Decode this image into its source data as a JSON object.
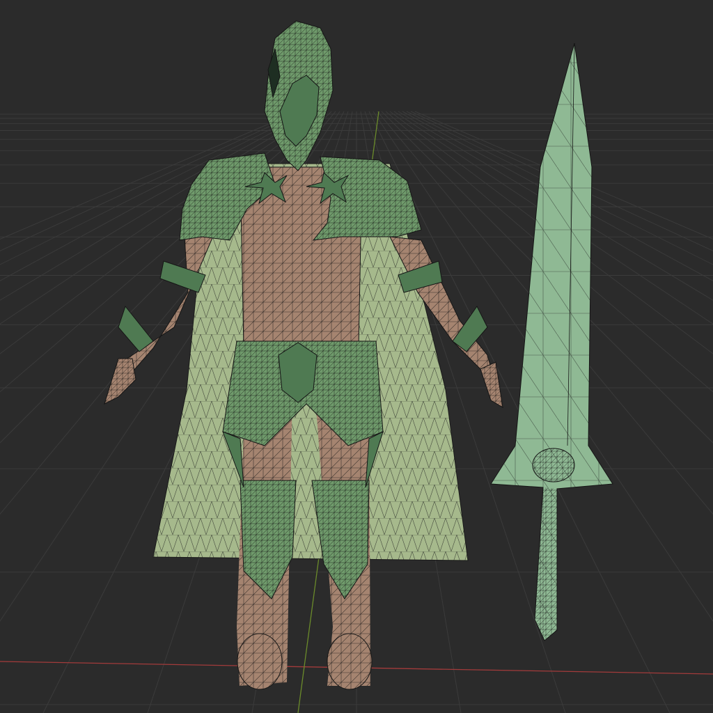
{
  "viewport": {
    "background": "#2b2b2b",
    "grid_color": "#3b3b3b",
    "x_axis_color": "#a83a3a",
    "y_axis_color": "#6a8a2a"
  },
  "scene": {
    "objects": [
      {
        "name": "armored-knight-character",
        "mesh_display": "wireframe-overlay"
      },
      {
        "name": "cape",
        "mesh_display": "wireframe-overlay"
      },
      {
        "name": "greatsword",
        "mesh_display": "wireframe-overlay"
      }
    ],
    "colors": {
      "armor": "#6f9a6b",
      "armor_dark": "#4f7a52",
      "skin": "#a58470",
      "cape": "#a6b98c",
      "sword": "#8fb994",
      "wire": "#151515"
    }
  }
}
